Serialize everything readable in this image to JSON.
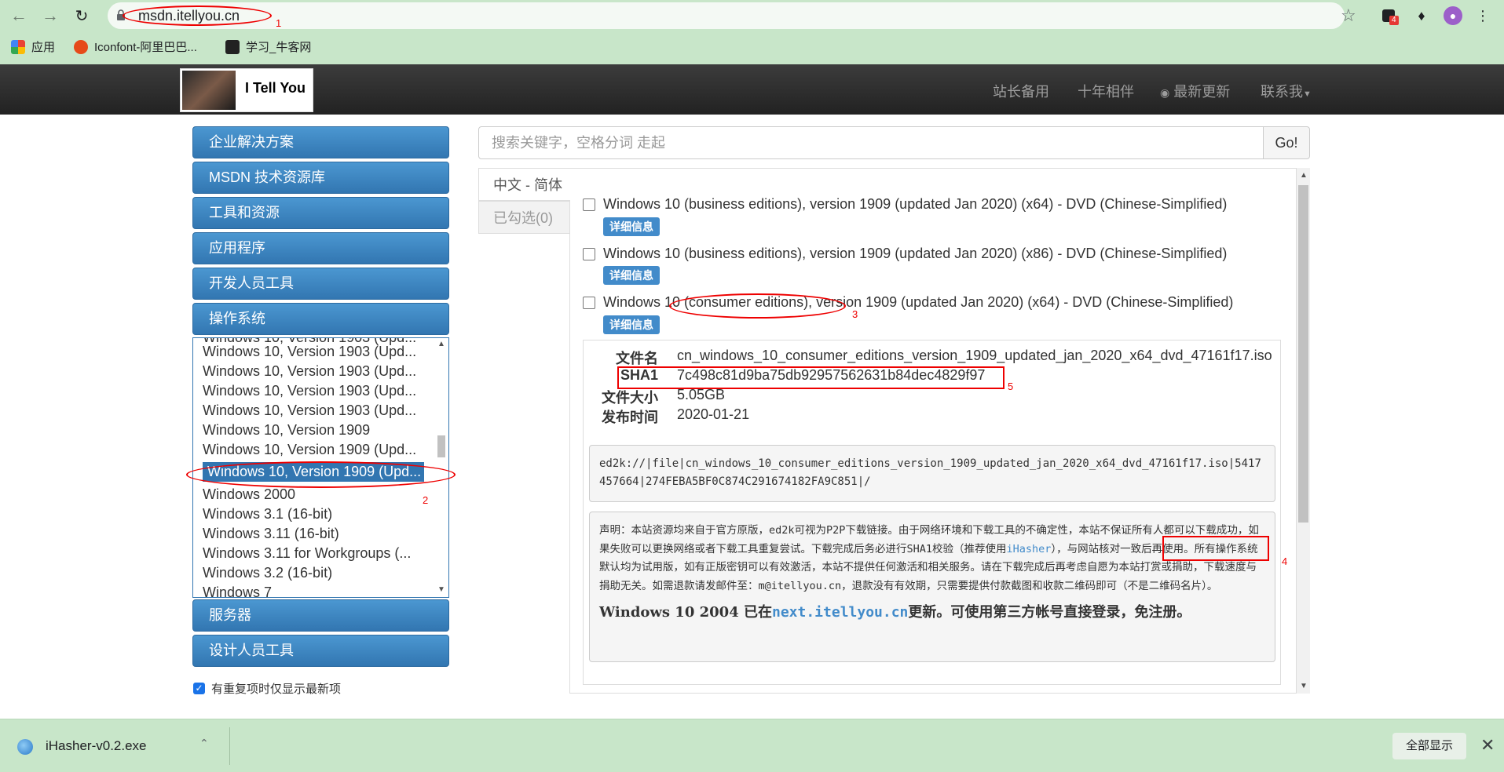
{
  "browser": {
    "url": "msdn.itellyou.cn",
    "bookmarks": [
      {
        "label": "应用",
        "icon": "apps-grid-icon"
      },
      {
        "label": "Iconfont-阿里巴巴...",
        "icon": "iconfont-icon"
      },
      {
        "label": "学习_牛客网",
        "icon": "nowcoder-icon"
      }
    ],
    "extension_badge": "4"
  },
  "site": {
    "logo_text": "I Tell You",
    "nav": [
      "站长备用",
      "十年相伴",
      "最新更新",
      "联系我"
    ]
  },
  "sidebar": {
    "menu_top": [
      "企业解决方案",
      "MSDN 技术资源库",
      "工具和资源",
      "应用程序",
      "开发人员工具",
      "操作系统"
    ],
    "os_items": [
      "Windows 10, Version 1903 (Upd...",
      "Windows 10, Version 1903 (Upd...",
      "Windows 10, Version 1903 (Upd...",
      "Windows 10, Version 1903 (Upd...",
      "Windows 10, Version 1909",
      "Windows 10, Version 1909 (Upd...",
      "Windows 10, Version 1909 (Upd...",
      "Windows 2000",
      "Windows 3.1 (16-bit)",
      "Windows 3.11 (16-bit)",
      "Windows 3.11 for Workgroups (...",
      "Windows 3.2 (16-bit)",
      "Windows 7"
    ],
    "menu_bottom": [
      "服务器",
      "设计人员工具"
    ],
    "checkbox_label": "有重复项时仅显示最新项"
  },
  "search": {
    "placeholder": "搜索关键字，空格分词 走起",
    "go_label": "Go!"
  },
  "tabs": {
    "active": "中文 - 简体",
    "selected": "已勾选(0)"
  },
  "entries": [
    {
      "title": "Windows 10 (business editions), version 1909 (updated Jan 2020) (x64) - DVD (Chinese-Simplified)"
    },
    {
      "title": "Windows 10 (business editions), version 1909 (updated Jan 2020) (x86) - DVD (Chinese-Simplified)"
    },
    {
      "title": "Windows 10 (consumer editions), version 1909 (updated Jan 2020) (x64) - DVD (Chinese-Simplified)"
    }
  ],
  "detail_label": "详细信息",
  "info": {
    "filename_label": "文件名",
    "filename": "cn_windows_10_consumer_editions_version_1909_updated_jan_2020_x64_dvd_47161f17.iso",
    "sha1_label": "SHA1",
    "sha1": "7c498c81d9ba75db92957562631b84dec4829f97",
    "size_label": "文件大小",
    "size": "5.05GB",
    "date_label": "发布时间",
    "date": "2020-01-21",
    "ed2k": "ed2k://|file|cn_windows_10_consumer_editions_version_1909_updated_jan_2020_x64_dvd_47161f17.iso|5417457664|274FEBA5BF0C874C291674182FA9C851|/",
    "notice_a": "声明：本站资源均来自于官方原版，ed2k可视为P2P下载链接。由于网络环境和下载工具的不确定性，本站不保证所有人都可以下载成功，如果失败可以更换网络或者下载工具重复尝试。下载完成后务必进行SHA1校验（推荐使用",
    "notice_link": "iHasher",
    "notice_b": "），与网站核对一致后再使用。所有操作系统默认均为试用版，如有正版密钥可以有效激活，本站不提供任何激活和相关服务。请在下载完成后再考虑自愿为本站打赏或捐助，下载速度与捐助无关。如需退款请发邮件至：m@itellyou.cn，退款没有有效期，只需要提供付款截图和收款二维码即可（不是二维码名片）。",
    "big_a": "Windows 10 2004 已在",
    "big_link": "next.itellyou.cn",
    "big_b": "更新。可使用第三方帐号直接登录，免注册。"
  },
  "annotations": [
    "1",
    "2",
    "3",
    "4",
    "5"
  ],
  "download": {
    "filename": "iHasher-v0.2.exe",
    "show_all": "全部显示"
  }
}
